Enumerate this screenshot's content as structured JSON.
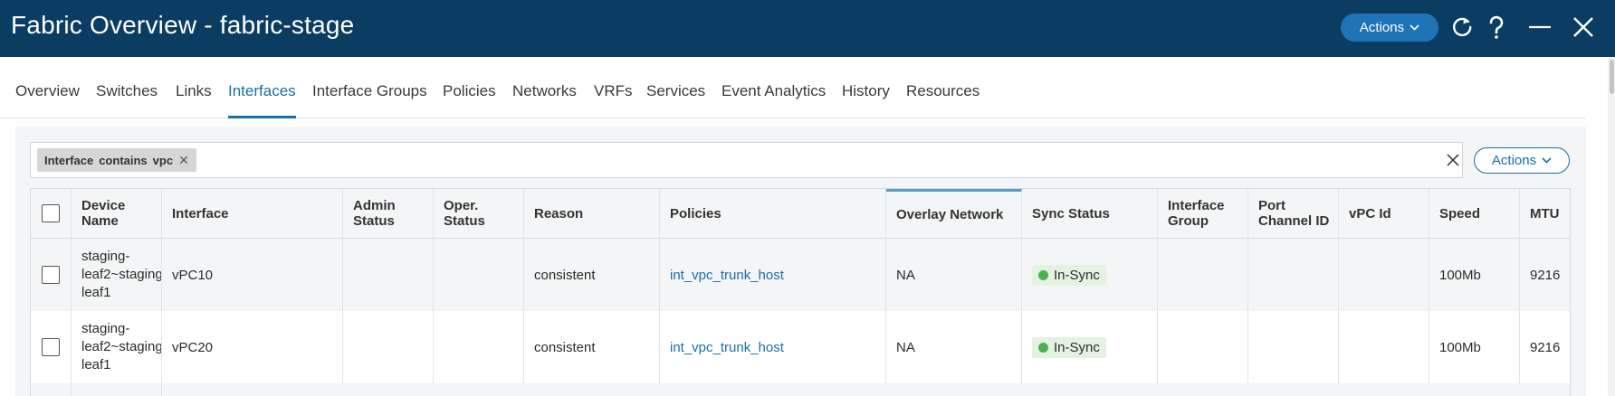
{
  "header": {
    "title": "Fabric Overview - fabric-stage",
    "actions_label": "Actions",
    "icons": [
      "refresh-icon",
      "help-icon",
      "minimize-icon",
      "close-icon"
    ]
  },
  "tabs": [
    {
      "label": "Overview"
    },
    {
      "label": "Switches"
    },
    {
      "label": "Links"
    },
    {
      "label": "Interfaces",
      "active": true
    },
    {
      "label": "Interface Groups"
    },
    {
      "label": "Policies"
    },
    {
      "label": "Networks"
    },
    {
      "label": "VRFs"
    },
    {
      "label": "Services"
    },
    {
      "label": "Event Analytics"
    },
    {
      "label": "History"
    },
    {
      "label": "Resources"
    }
  ],
  "filter": {
    "chip_field": "Interface",
    "chip_op": "contains",
    "chip_value": "vpc"
  },
  "toolbar": {
    "actions_label": "Actions"
  },
  "table": {
    "columns": {
      "device_name": "Device Name",
      "interface": "Interface",
      "admin_status": "Admin Status",
      "oper_status": "Oper. Status",
      "reason": "Reason",
      "policies": "Policies",
      "overlay_network": "Overlay Network",
      "sync_status": "Sync Status",
      "interface_group": "Interface Group",
      "port_channel_id": "Port Channel ID",
      "vpc_id": "vPC Id",
      "speed": "Speed",
      "mtu": "MTU"
    },
    "rows": [
      {
        "device_name": "staging-leaf2~staging leaf1",
        "interface": "vPC10",
        "admin_status": "",
        "oper_status": "",
        "reason": "consistent",
        "policies": "int_vpc_trunk_host",
        "overlay_network": "NA",
        "sync_status": "In-Sync",
        "interface_group": "",
        "port_channel_id": "",
        "vpc_id": "",
        "speed": "100Mb",
        "mtu": "9216"
      },
      {
        "device_name": "staging-leaf2~staging leaf1",
        "interface": "vPC20",
        "admin_status": "",
        "oper_status": "",
        "reason": "consistent",
        "policies": "int_vpc_trunk_host",
        "overlay_network": "NA",
        "sync_status": "In-Sync",
        "interface_group": "",
        "port_channel_id": "",
        "vpc_id": "",
        "speed": "100Mb",
        "mtu": "9216"
      }
    ]
  },
  "colors": {
    "header_bg": "#0b3d63",
    "accent": "#1a6fa8",
    "in_sync": "#4caf50"
  }
}
